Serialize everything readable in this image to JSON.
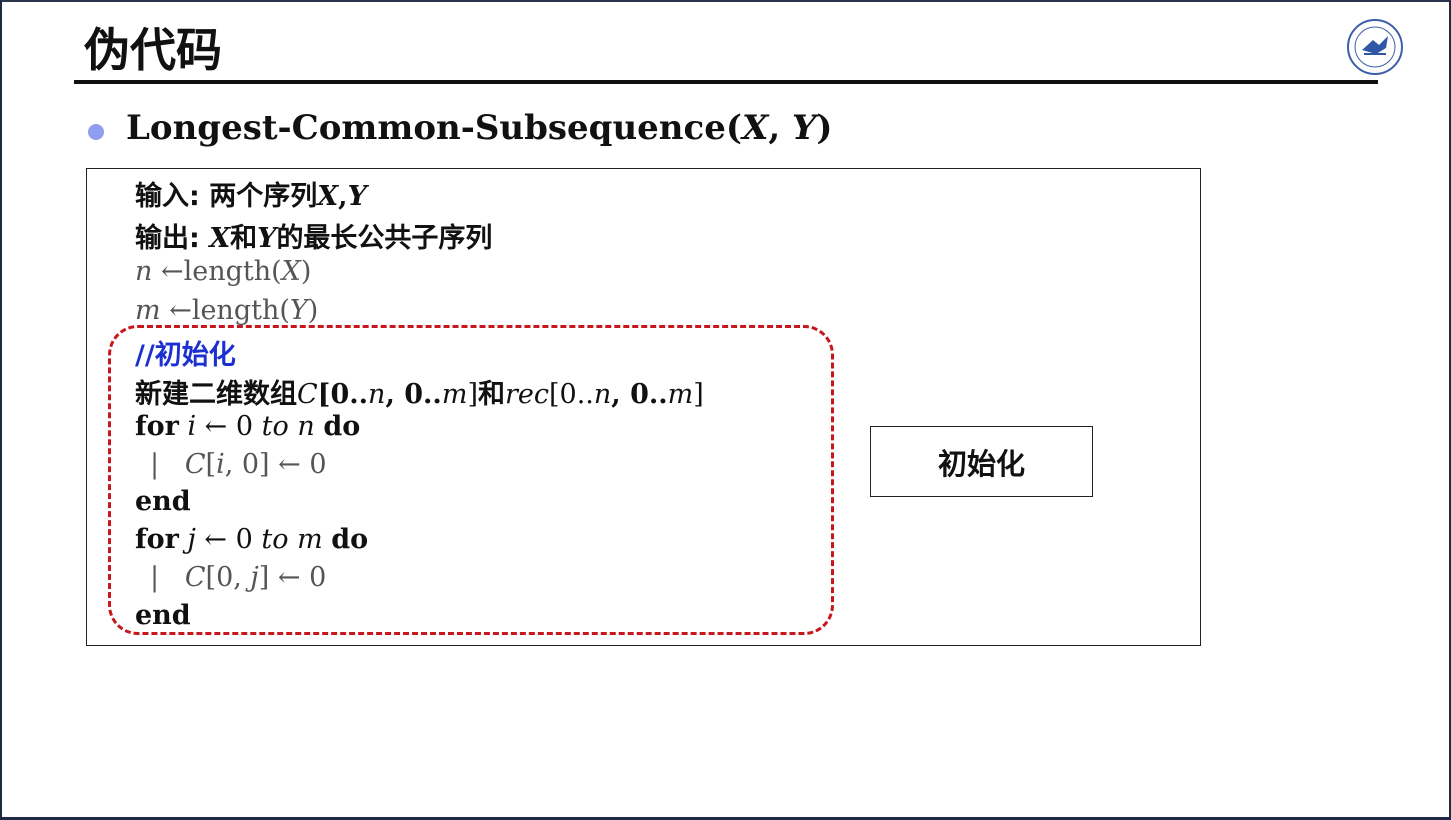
{
  "slide": {
    "title": "伪代码",
    "bullet": {
      "prefix": "Longest-Common-Subsequence(",
      "x": "X",
      "comma": ", ",
      "y": "Y",
      "suffix": ")"
    }
  },
  "algorithm": {
    "input": {
      "label": "输入: 两个序列",
      "x": "X",
      "sep": ",",
      "y": "Y"
    },
    "output": {
      "label": "输出: ",
      "x": "X",
      "mid": "和",
      "y": "Y",
      "rest": "的最长公共子序列"
    },
    "line_n": {
      "var": "n",
      "arrow": " ←length(",
      "arg": "X",
      "close": ")"
    },
    "line_m": {
      "var": "m",
      "arrow": " ←length(",
      "arg": "Y",
      "close": ")"
    },
    "comment": "//初始化",
    "create": {
      "prefix": "新建二维数组",
      "c_array": "C",
      "c_range_1": "[0..",
      "n": "n",
      "c_range_2": ", 0..",
      "m": "m",
      "c_range_3": "]",
      "and": "和",
      "rec_array": "rec",
      "rec_range_1": "[0..",
      "rec_n": "n",
      "rec_range_2": ", 0..",
      "rec_m": "m",
      "rec_range_3": "]"
    },
    "loop1": {
      "for": "for",
      "var": "i",
      "arrow": " ← 0 ",
      "to": "to",
      "bound": "n",
      "do": "do",
      "bar": "|",
      "body_c": "C",
      "body_open": "[",
      "body_idx": "i",
      "body_rest": ", 0] ← 0",
      "end": "end"
    },
    "loop2": {
      "for": "for",
      "var": "j",
      "arrow": " ← 0 ",
      "to": "to",
      "bound": "m",
      "do": "do",
      "bar": "|",
      "body_c": "C",
      "body_open": "[0, ",
      "body_idx": "j",
      "body_rest": "] ← 0",
      "end": "end"
    }
  },
  "annotation": {
    "label": "初始化",
    "dash_color": "#c8161d"
  },
  "colors": {
    "bullet": "#8f9ff0",
    "comment": "#1c2fd0"
  }
}
